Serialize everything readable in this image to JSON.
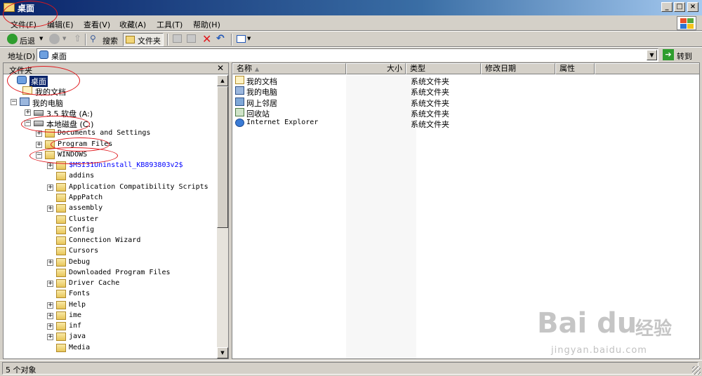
{
  "window": {
    "title": "桌面"
  },
  "menubar": {
    "items": [
      "文件(F)",
      "编辑(E)",
      "查看(V)",
      "收藏(A)",
      "工具(T)",
      "帮助(H)"
    ]
  },
  "toolbar": {
    "back_label": "后退",
    "search_label": "搜索",
    "folders_label": "文件夹"
  },
  "address": {
    "label": "地址(D)",
    "value": "桌面",
    "go_label": "转到"
  },
  "folder_pane": {
    "title": "文件夹",
    "tree": [
      {
        "label": "桌面",
        "depth": 0,
        "expander": "",
        "icon": "desktop-icon",
        "selected": true
      },
      {
        "label": "我的文档",
        "depth": 1,
        "expander": "",
        "icon": "documents-icon"
      },
      {
        "label": "我的电脑",
        "depth": 1,
        "expander": "-",
        "icon": "computer-icon"
      },
      {
        "label": "3.5 软盘 (A:)",
        "depth": 2,
        "expander": "+",
        "icon": "floppy-icon"
      },
      {
        "label": "本地磁盘 (C:)",
        "depth": 2,
        "expander": "-",
        "icon": "drive-icon"
      },
      {
        "label": "Documents and Settings",
        "depth": 3,
        "expander": "+",
        "icon": "folder-icon"
      },
      {
        "label": "Program Files",
        "depth": 3,
        "expander": "+",
        "icon": "folder-icon"
      },
      {
        "label": "WINDOWS",
        "depth": 3,
        "expander": "-",
        "icon": "folder-icon"
      },
      {
        "label": "$MSI31Uninstall_KB893803v2$",
        "depth": 4,
        "expander": "+",
        "icon": "folder-icon",
        "blue": true
      },
      {
        "label": "addins",
        "depth": 4,
        "expander": "",
        "icon": "folder-icon"
      },
      {
        "label": "Application Compatibility Scripts",
        "depth": 4,
        "expander": "+",
        "icon": "folder-icon"
      },
      {
        "label": "AppPatch",
        "depth": 4,
        "expander": "",
        "icon": "folder-icon"
      },
      {
        "label": "assembly",
        "depth": 4,
        "expander": "+",
        "icon": "folder-icon"
      },
      {
        "label": "Cluster",
        "depth": 4,
        "expander": "",
        "icon": "folder-icon"
      },
      {
        "label": "Config",
        "depth": 4,
        "expander": "",
        "icon": "folder-icon"
      },
      {
        "label": "Connection Wizard",
        "depth": 4,
        "expander": "",
        "icon": "folder-icon"
      },
      {
        "label": "Cursors",
        "depth": 4,
        "expander": "",
        "icon": "folder-icon"
      },
      {
        "label": "Debug",
        "depth": 4,
        "expander": "+",
        "icon": "folder-icon"
      },
      {
        "label": "Downloaded Program Files",
        "depth": 4,
        "expander": "",
        "icon": "folder-icon"
      },
      {
        "label": "Driver Cache",
        "depth": 4,
        "expander": "+",
        "icon": "folder-icon"
      },
      {
        "label": "Fonts",
        "depth": 4,
        "expander": "",
        "icon": "folder-icon"
      },
      {
        "label": "Help",
        "depth": 4,
        "expander": "+",
        "icon": "folder-icon"
      },
      {
        "label": "ime",
        "depth": 4,
        "expander": "+",
        "icon": "folder-icon"
      },
      {
        "label": "inf",
        "depth": 4,
        "expander": "+",
        "icon": "folder-icon"
      },
      {
        "label": "java",
        "depth": 4,
        "expander": "+",
        "icon": "folder-icon"
      },
      {
        "label": "Media",
        "depth": 4,
        "expander": "",
        "icon": "folder-icon"
      }
    ]
  },
  "file_pane": {
    "columns": [
      "名称",
      "大小",
      "类型",
      "修改日期",
      "属性"
    ],
    "rows": [
      {
        "name": "我的文档",
        "type": "系统文件夹",
        "icon": "documents-icon"
      },
      {
        "name": "我的电脑",
        "type": "系统文件夹",
        "icon": "computer-icon"
      },
      {
        "name": "网上邻居",
        "type": "系统文件夹",
        "icon": "network-icon"
      },
      {
        "name": "回收站",
        "type": "系统文件夹",
        "icon": "recycle-bin-icon"
      },
      {
        "name": "Internet Explorer",
        "type": "系统文件夹",
        "icon": "ie-icon"
      }
    ]
  },
  "statusbar": {
    "text": "5 个对象"
  },
  "watermark": {
    "logo": "Bai du",
    "cn": "经验",
    "url": "jingyan.baidu.com"
  },
  "colors": {
    "titlebar": "#0a246a",
    "selection": "#0a246a",
    "annotation": "#e0161b",
    "face": "#d4d0c8"
  }
}
